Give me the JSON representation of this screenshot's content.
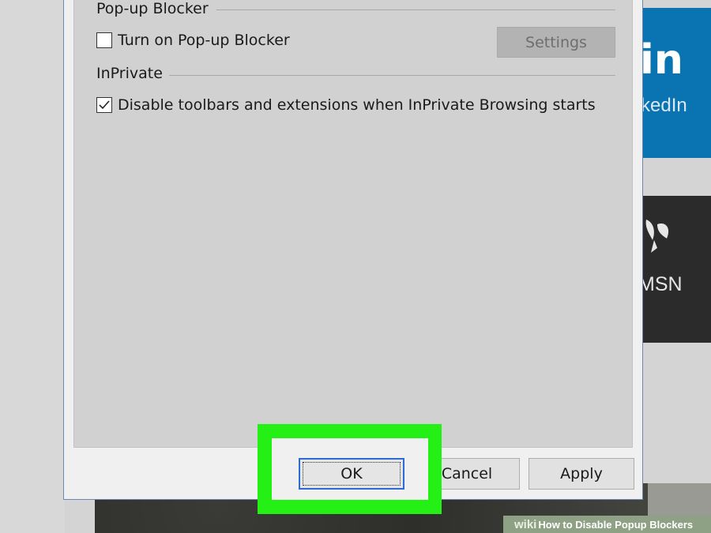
{
  "background": {
    "tiles": {
      "linkedin_logo_text": "in",
      "linkedin_label": "kedIn",
      "msn_label": "MSN"
    }
  },
  "dialog": {
    "popup_group": {
      "title": "Pop-up Blocker",
      "checkbox_label": "Turn on Pop-up Blocker",
      "checked": false,
      "settings_button": "Settings"
    },
    "inprivate_group": {
      "title": "InPrivate",
      "checkbox_label": "Disable toolbars and extensions when InPrivate Browsing starts",
      "checked": true
    },
    "buttons": {
      "ok": "OK",
      "cancel": "Cancel",
      "apply": "Apply"
    }
  },
  "watermark": {
    "brand": "wiki",
    "text": "How to Disable Popup Blockers"
  },
  "colors": {
    "highlight": "#24f016",
    "linkedin_blue": "#0a73b1",
    "msn_dark": "#2b2b2b",
    "dialog_border": "#6f87b0"
  }
}
